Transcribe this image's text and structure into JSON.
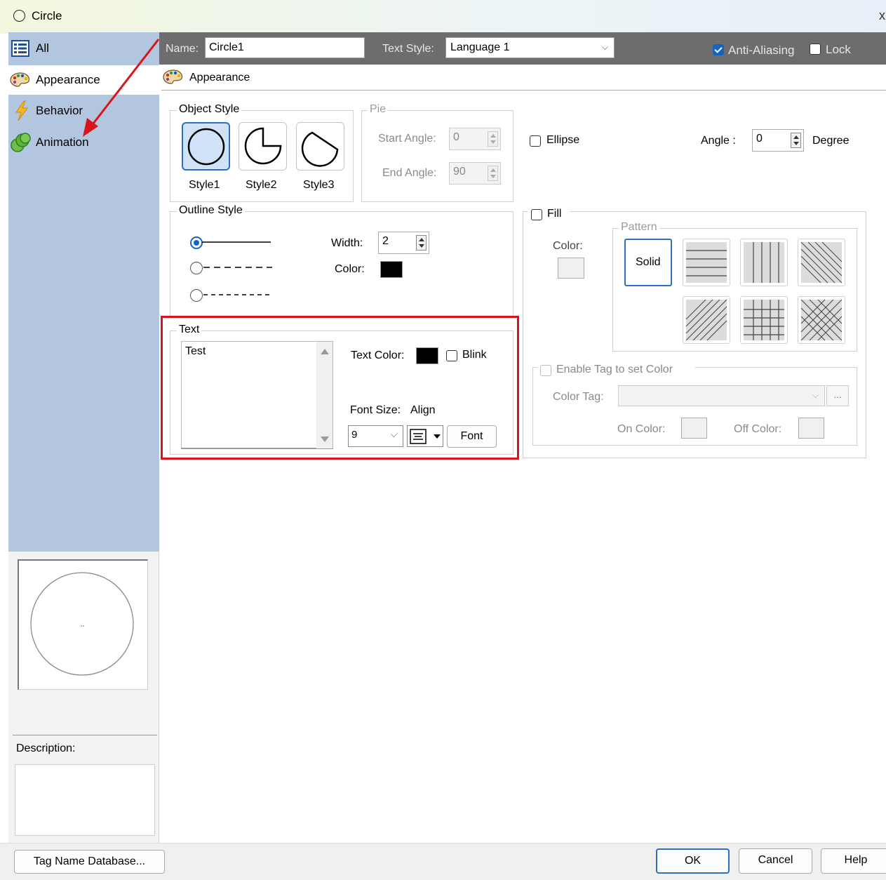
{
  "window": {
    "title": "Circle",
    "close_glyph": "x"
  },
  "sidebar": {
    "items": [
      {
        "label": "All",
        "icon": "list-icon"
      },
      {
        "label": "Appearance",
        "icon": "palette-icon",
        "selected": true
      },
      {
        "label": "Behavior",
        "icon": "lightning-icon"
      },
      {
        "label": "Animation",
        "icon": "animation-icon"
      }
    ],
    "description_label": "Description:"
  },
  "topbar": {
    "name_label": "Name:",
    "name_value": "Circle1",
    "text_style_label": "Text Style:",
    "text_style_value": "Language 1",
    "anti_aliasing_label": "Anti-Aliasing",
    "anti_aliasing_checked": true,
    "lock_label": "Lock",
    "lock_checked": false
  },
  "section": {
    "title": "Appearance"
  },
  "object_style": {
    "title": "Object Style",
    "styles": [
      "Style1",
      "Style2",
      "Style3"
    ],
    "selected": "Style1"
  },
  "pie": {
    "title": "Pie",
    "start_angle_label": "Start Angle:",
    "start_angle_value": "0",
    "end_angle_label": "End Angle:",
    "end_angle_value": "90"
  },
  "ellipse": {
    "label": "Ellipse",
    "checked": false
  },
  "angle": {
    "label": "Angle :",
    "value": "0",
    "unit": "Degree"
  },
  "outline": {
    "title": "Outline Style",
    "width_label": "Width:",
    "width_value": "2",
    "color_label": "Color:",
    "color": "#000000"
  },
  "fill": {
    "label": "Fill",
    "checked": false,
    "color_label": "Color:",
    "pattern_title": "Pattern",
    "solid_label": "Solid"
  },
  "tag_color": {
    "label": "Enable Tag to set Color",
    "color_tag_label": "Color  Tag:",
    "browse_label": "...",
    "on_color_label": "On Color:",
    "off_color_label": "Off Color:"
  },
  "text": {
    "title": "Text",
    "content": "Test",
    "text_color_label": "Text Color:",
    "text_color": "#000000",
    "blink_label": "Blink",
    "font_size_label": "Font Size:",
    "align_label": "Align",
    "font_size_value": "9",
    "font_button": "Font"
  },
  "buttons": {
    "tag_db": "Tag Name Database...",
    "ok": "OK",
    "cancel": "Cancel",
    "help": "Help"
  },
  "colors": {
    "sidebar_bg": "#b3c6e0",
    "topbar_bg": "#6d6d6d",
    "accent": "#1565c0",
    "annotation": "#d9141a"
  }
}
